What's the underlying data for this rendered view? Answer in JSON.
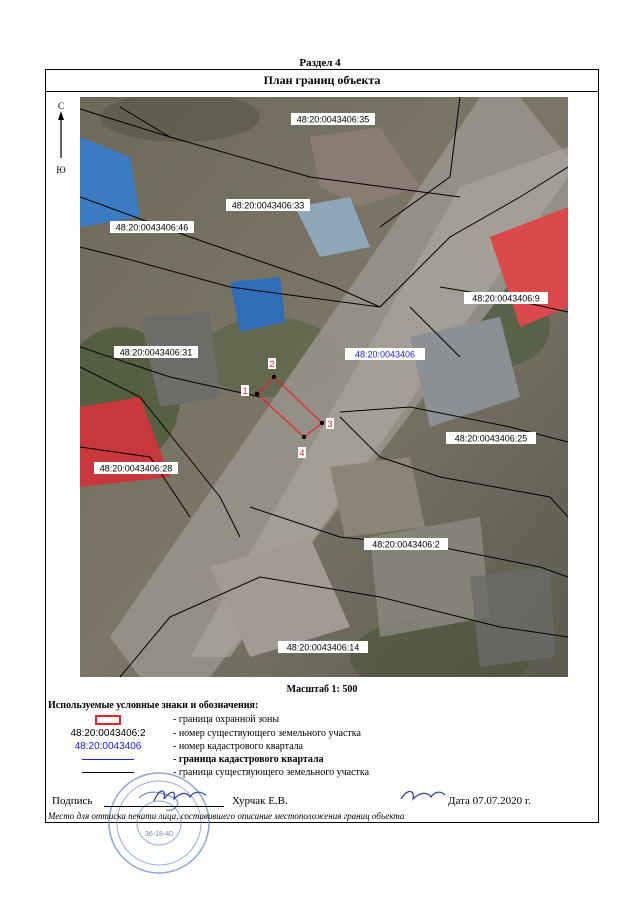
{
  "section_title": "Раздел 4",
  "plan_title": "План границ объекта",
  "compass": {
    "north": "С",
    "south": "Ю",
    "icon": "north-arrow-icon"
  },
  "map": {
    "parcels": [
      "48:20:0043406:35",
      "48:20:0043406:33",
      "48:20:0043406:46",
      "48:20:0043406:9",
      "48:20:0043406:31",
      "48:20:0043406:25",
      "48:20:0043406:28",
      "48:20:0043406:2",
      "48:20:0043406:14"
    ],
    "quarter": "48:20:0043406",
    "points": [
      "1",
      "2",
      "3",
      "4"
    ],
    "colors": {
      "zone": "#e8202a",
      "quarter_label": "#1a1aff",
      "parcel_line": "#000000"
    }
  },
  "scale": "Масштаб 1: 500",
  "legend": {
    "title": "Используемые условные знаки и обозначения:",
    "items": [
      {
        "symbol": "",
        "desc": "- граница  охранной зоны"
      },
      {
        "symbol": "48:20:0043406:2",
        "desc": "- номер существующего земельного участка"
      },
      {
        "symbol": "48:20:0043406",
        "desc": "- номер кадастрового квартала"
      },
      {
        "symbol": "",
        "desc": "- граница кадастрового квартала"
      },
      {
        "symbol": "",
        "desc": "- граница существующего земельного участка"
      }
    ]
  },
  "signature": {
    "label": "Подпись",
    "name": "Хурчак Е.В.",
    "date": "Дата 07.07.2020 г."
  },
  "caption": "Место для оттиска печати лица, составившего описание местоположения границ объекта",
  "stamp": {
    "number": "36-18-40"
  }
}
